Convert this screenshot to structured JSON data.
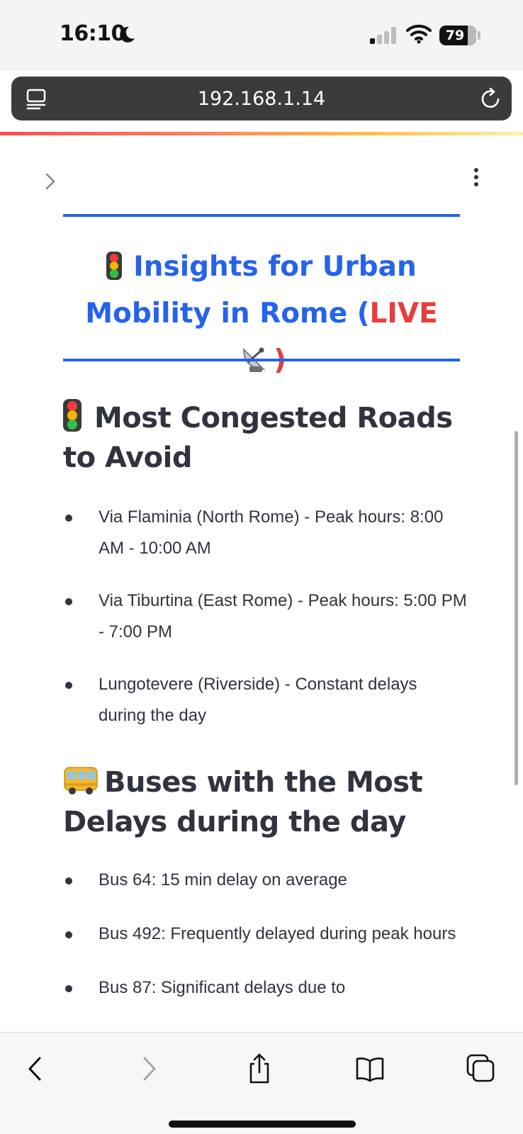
{
  "status_bar": {
    "time": "16:10",
    "battery": "79",
    "icons": [
      "moon-icon",
      "cellular-signal-icon",
      "wifi-icon",
      "battery-icon"
    ]
  },
  "browser": {
    "url": "192.168.1.14",
    "icons": [
      "reader-icon",
      "reload-icon"
    ]
  },
  "page": {
    "title_part1": "Insights for Urban Mobility in Rome (",
    "title_live": "LIVE",
    "title_close": ")",
    "sections": [
      {
        "heading": "Most Congested Roads to Avoid",
        "icon": "traffic-light-icon",
        "items": [
          "Via Flaminia (North Rome) - Peak hours: 8:00 AM - 10:00 AM",
          "Via Tiburtina (East Rome) - Peak hours: 5:00 PM - 7:00 PM",
          "Lungotevere (Riverside) - Constant delays during the day"
        ]
      },
      {
        "heading": "Buses with the Most Delays during the day",
        "icon": "bus-icon",
        "items": [
          "Bus 64: 15 min delay on average",
          "Bus 492: Frequently delayed during peak hours",
          "Bus 87: Significant delays due to"
        ]
      }
    ]
  },
  "colors": {
    "accent": "#2563eb",
    "live": "#e53e3e",
    "text": "#31333f"
  },
  "toolbar": {
    "icons": [
      "back-icon",
      "forward-icon",
      "share-icon",
      "bookmarks-icon",
      "tabs-icon"
    ]
  }
}
